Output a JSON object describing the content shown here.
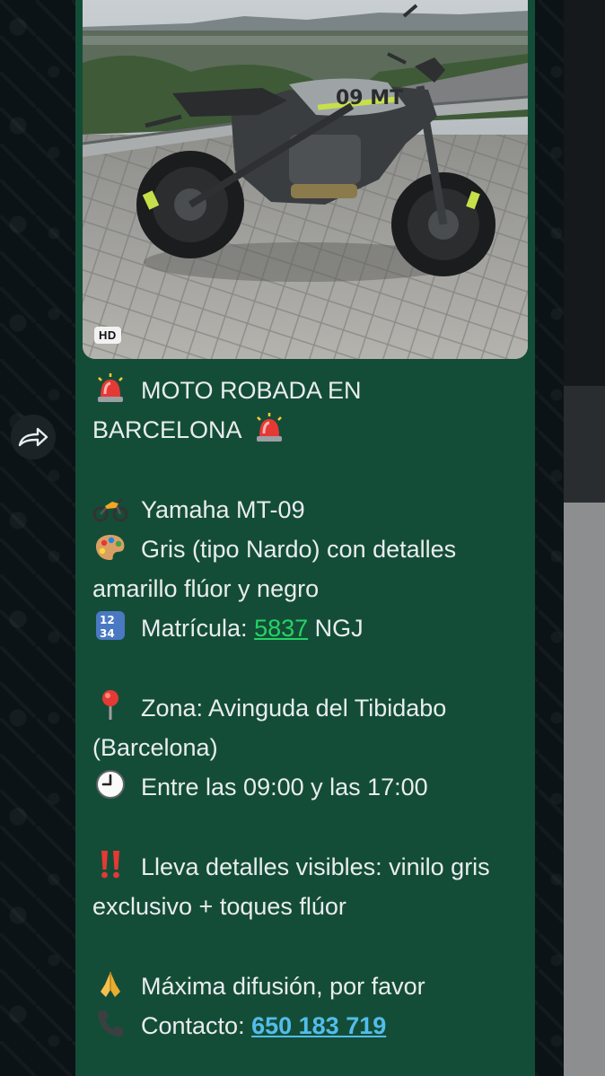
{
  "media": {
    "badge": "HD",
    "photo_subject": "grey Yamaha MT-09 motorcycle parked on a tiled viewpoint overlooking Barcelona",
    "tank_decal": "09 MT"
  },
  "message": {
    "title_line1": "MOTO ROBADA EN",
    "title_line2": "BARCELONA",
    "model": "Yamaha MT-09",
    "color_desc": "Gris (tipo Nardo) con detalles amarillo flúor y negro",
    "plate_label": "Matrícula:",
    "plate_number": "5837",
    "plate_letters": "NGJ",
    "zone": "Zona: Avinguda del Tibidabo (Barcelona)",
    "time": "Entre las 09:00 y las 17:00",
    "details": "Lleva detalles visibles: vinilo gris exclusivo + toques flúor",
    "spread": "Máxima difusión, por favor",
    "contact_label": "Contacto:",
    "contact_phone": "650 183 719"
  },
  "icons": {
    "siren": "police-siren-icon",
    "motorcycle": "motorcycle-icon",
    "palette": "artist-palette-icon",
    "numbers": "input-numbers-icon",
    "pin": "round-pushpin-icon",
    "clock": "clock-icon",
    "exclamation": "double-exclamation-icon",
    "pray": "folded-hands-icon",
    "phone": "telephone-icon",
    "forward": "forward-arrow-icon"
  },
  "colors": {
    "bubble": "#144d37",
    "text": "#e9edef",
    "plate_link": "#25d366",
    "phone_link": "#53bdeb"
  }
}
